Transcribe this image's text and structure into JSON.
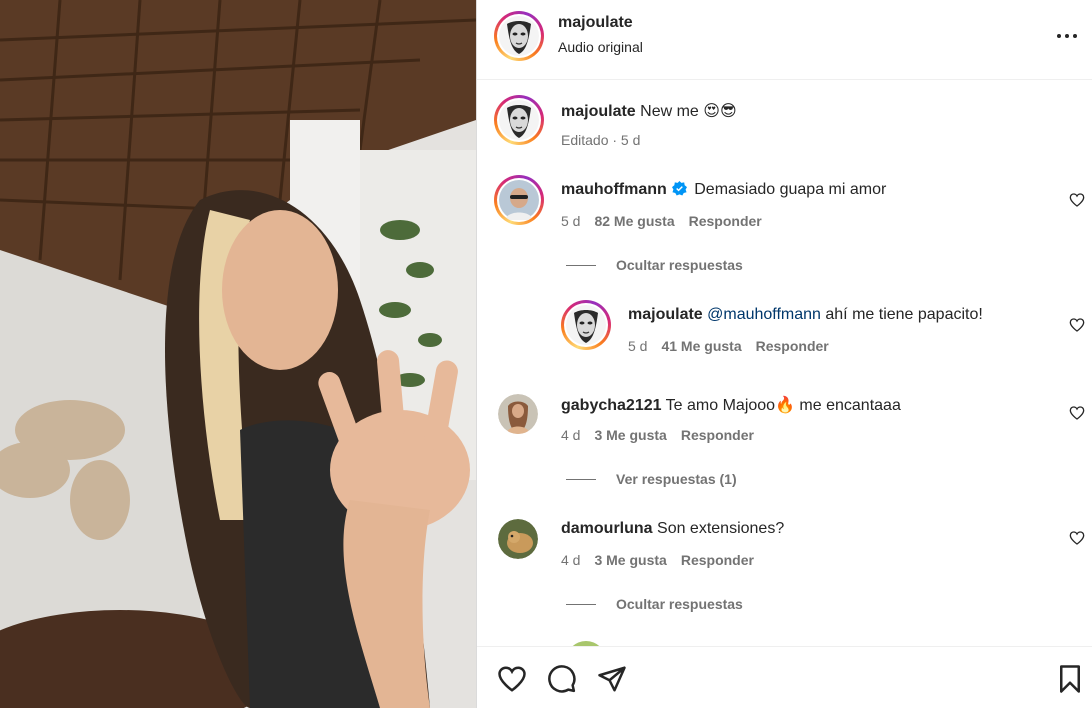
{
  "header": {
    "username": "majoulate",
    "subtitle": "Audio original",
    "more_icon": "more-horizontal-icon"
  },
  "caption": {
    "username": "majoulate",
    "text": "New me 😍😎",
    "meta": "Editado · 5 d"
  },
  "comments": [
    {
      "username": "mauhoffmann",
      "verified": true,
      "text": "Demasiado guapa mi amor",
      "age": "5 d",
      "likes": "82 Me gusta",
      "reply_label": "Responder",
      "replies_toggle": "Ocultar respuestas",
      "replies": [
        {
          "username": "majoulate",
          "mention": "@mauhoffmann",
          "text": " ahí me tiene papacito!",
          "age": "5 d",
          "likes": "41 Me gusta",
          "reply_label": "Responder"
        }
      ]
    },
    {
      "username": "gabycha2121",
      "text": "Te amo Majooo🔥 me encantaaa",
      "age": "4 d",
      "likes": "3 Me gusta",
      "reply_label": "Responder",
      "replies_toggle": "Ver respuestas (1)"
    },
    {
      "username": "damourluna",
      "text": "Son extensiones?",
      "age": "4 d",
      "likes": "3 Me gusta",
      "reply_label": "Responder",
      "replies_toggle": "Ocultar respuestas"
    }
  ],
  "actions": {
    "like_icon": "heart-icon",
    "comment_icon": "comment-icon",
    "share_icon": "send-icon",
    "save_icon": "bookmark-icon"
  },
  "colors": {
    "text": "#262626",
    "secondary": "#737373",
    "mention": "#00376b",
    "verified": "#0095f6"
  }
}
